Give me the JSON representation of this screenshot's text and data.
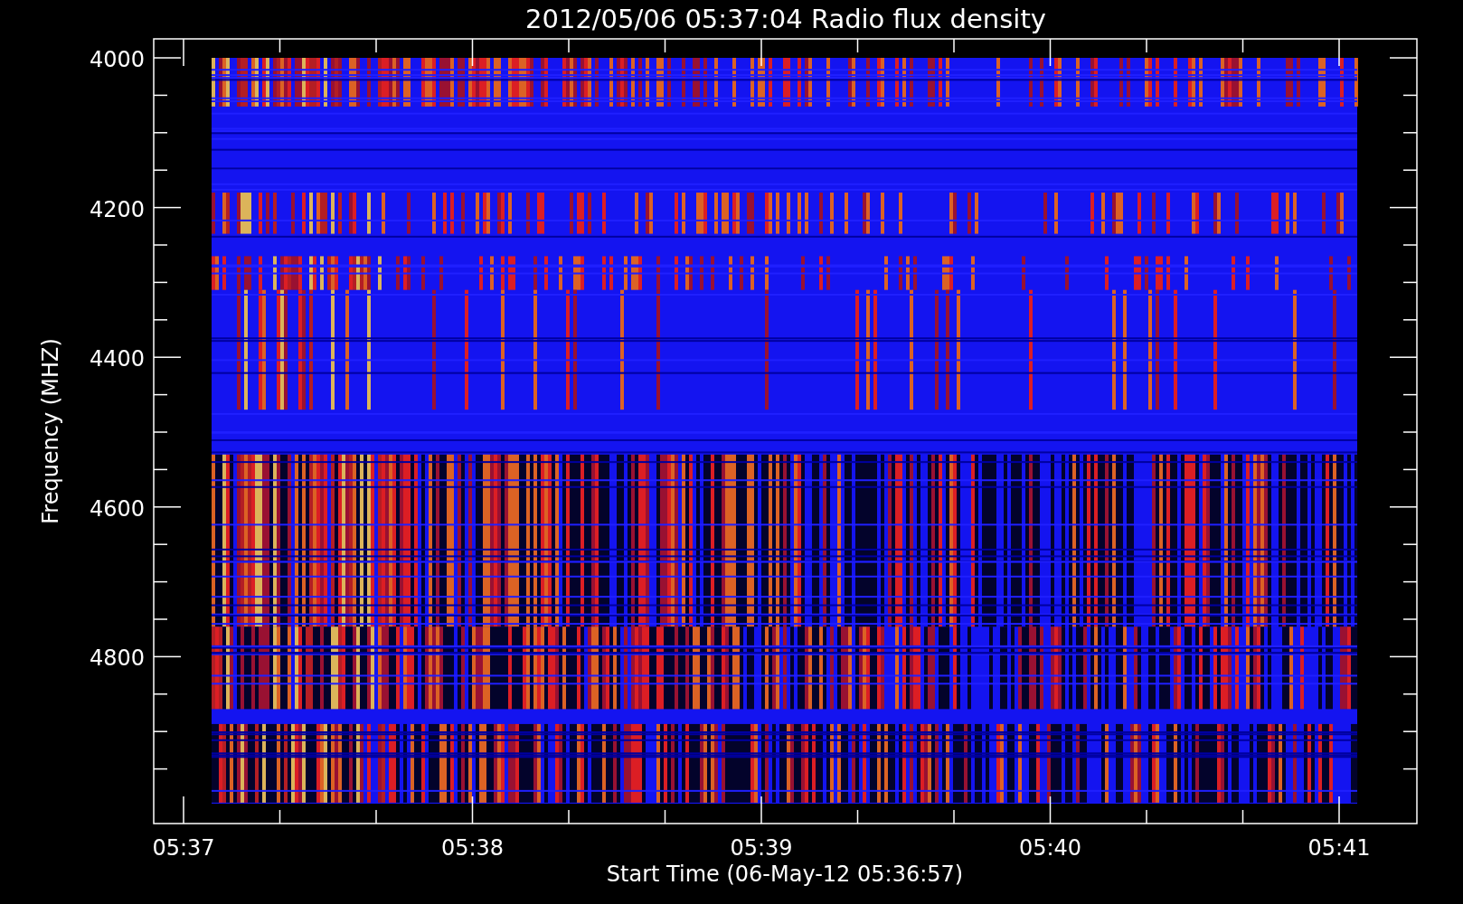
{
  "title": "2012/05/06 05:37:04 Radio flux density",
  "y_axis": {
    "label": "Frequency (MHZ)",
    "ticks": [
      "4000",
      "4200",
      "4400",
      "4600",
      "4800"
    ]
  },
  "x_axis": {
    "label": "Start Time (06-May-12 05:36:57)",
    "ticks": [
      "05:37",
      "05:38",
      "05:39",
      "05:40",
      "05:41"
    ]
  }
}
